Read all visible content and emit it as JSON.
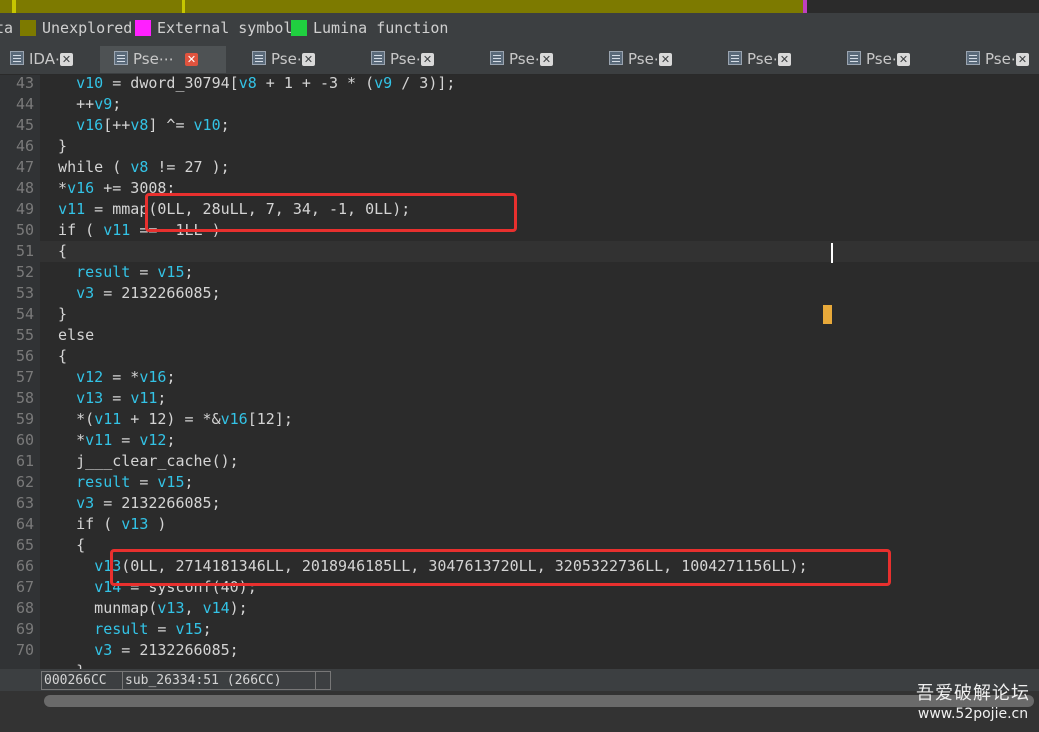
{
  "nav_band": {
    "colors": [
      "#7d7a00",
      "#c6c600",
      "#7d7a00",
      "#c6c600",
      "#7d7a00",
      "#c040c0",
      "#2b2b2b"
    ]
  },
  "legend": {
    "items": [
      {
        "label": "ta",
        "color": ""
      },
      {
        "label": "Unexplored",
        "color": "#7d7a00"
      },
      {
        "label": "External symbol",
        "color": "#ff20ff"
      },
      {
        "label": "Lumina function",
        "color": "#20d040"
      }
    ]
  },
  "tabs": [
    {
      "title": "IDA⋯",
      "active": false,
      "icon": "document-icon"
    },
    {
      "title": "Pse⋯",
      "active": true,
      "icon": "document-icon"
    },
    {
      "title": "Pse⋯",
      "active": false,
      "icon": "document-icon"
    },
    {
      "title": "Pse⋯",
      "active": false,
      "icon": "document-icon"
    },
    {
      "title": "Pse⋯",
      "active": false,
      "icon": "document-icon"
    },
    {
      "title": "Pse⋯",
      "active": false,
      "icon": "document-icon"
    },
    {
      "title": "Pse⋯",
      "active": false,
      "icon": "document-icon"
    },
    {
      "title": "Pse⋯",
      "active": false,
      "icon": "document-icon"
    },
    {
      "title": "Pse⋯",
      "active": false,
      "icon": "document-icon"
    }
  ],
  "tab_close_glyph": "✕",
  "code": {
    "lines": [
      {
        "num": "43",
        "text": "    v10 = dword_30794[v8 + 1 + -3 * (v9 / 3)];",
        "vars": [
          "v10",
          "v8",
          "v9"
        ]
      },
      {
        "num": "44",
        "text": "    ++v9;",
        "vars": [
          "v9"
        ]
      },
      {
        "num": "45",
        "text": "    v16[++v8] ^= v10;",
        "vars": [
          "v16",
          "v8",
          "v10"
        ]
      },
      {
        "num": "46",
        "text": "  }",
        "vars": []
      },
      {
        "num": "47",
        "text": "  while ( v8 != 27 );",
        "vars": [
          "v8"
        ]
      },
      {
        "num": "48",
        "text": "  *v16 += 3008;",
        "vars": [
          "v16"
        ]
      },
      {
        "num": "49",
        "text": "  v11 = mmap(0LL, 28uLL, 7, 34, -1, 0LL);",
        "vars": [
          "v11"
        ]
      },
      {
        "num": "50",
        "text": "  if ( v11 == -1LL )",
        "vars": [
          "v11"
        ]
      },
      {
        "num": "51",
        "text": "  {",
        "vars": [],
        "current": true
      },
      {
        "num": "52",
        "text": "    result = v15;",
        "vars": [
          "result",
          "v15"
        ]
      },
      {
        "num": "53",
        "text": "    v3 = 2132266085;",
        "vars": [
          "v3"
        ]
      },
      {
        "num": "54",
        "text": "  }",
        "vars": []
      },
      {
        "num": "55",
        "text": "  else",
        "vars": []
      },
      {
        "num": "56",
        "text": "  {",
        "vars": []
      },
      {
        "num": "57",
        "text": "    v12 = *v16;",
        "vars": [
          "v12",
          "v16"
        ]
      },
      {
        "num": "58",
        "text": "    v13 = v11;",
        "vars": [
          "v13",
          "v11"
        ]
      },
      {
        "num": "59",
        "text": "    *(v11 + 12) = *&v16[12];",
        "vars": [
          "v11",
          "v16"
        ]
      },
      {
        "num": "60",
        "text": "    *v11 = v12;",
        "vars": [
          "v11",
          "v12"
        ]
      },
      {
        "num": "61",
        "text": "    j___clear_cache();",
        "vars": []
      },
      {
        "num": "62",
        "text": "    result = v15;",
        "vars": [
          "result",
          "v15"
        ]
      },
      {
        "num": "63",
        "text": "    v3 = 2132266085;",
        "vars": [
          "v3"
        ]
      },
      {
        "num": "64",
        "text": "    if ( v13 )",
        "vars": [
          "v13"
        ]
      },
      {
        "num": "65",
        "text": "    {",
        "vars": []
      },
      {
        "num": "66",
        "text": "      v13(0LL, 2714181346LL, 2018946185LL, 3047613720LL, 3205322736LL, 1004271156LL);",
        "vars": [
          "v13"
        ]
      },
      {
        "num": "67",
        "text": "      v14 = sysconf(40);",
        "vars": [
          "v14"
        ]
      },
      {
        "num": "68",
        "text": "      munmap(v13, v14);",
        "vars": [
          "v13",
          "v14"
        ]
      },
      {
        "num": "69",
        "text": "      result = v15;",
        "vars": [
          "result",
          "v15"
        ]
      },
      {
        "num": "70",
        "text": "      v3 = 2132266085;",
        "vars": [
          "v3"
        ]
      },
      {
        "num": "",
        "text": "    }",
        "vars": []
      }
    ]
  },
  "status": {
    "address": "000266CC",
    "location": "sub_26334:51 (266CC)",
    "extra": ""
  },
  "watermark": {
    "title": "吾爱破解论坛",
    "url": "www.52pojie.cn"
  }
}
